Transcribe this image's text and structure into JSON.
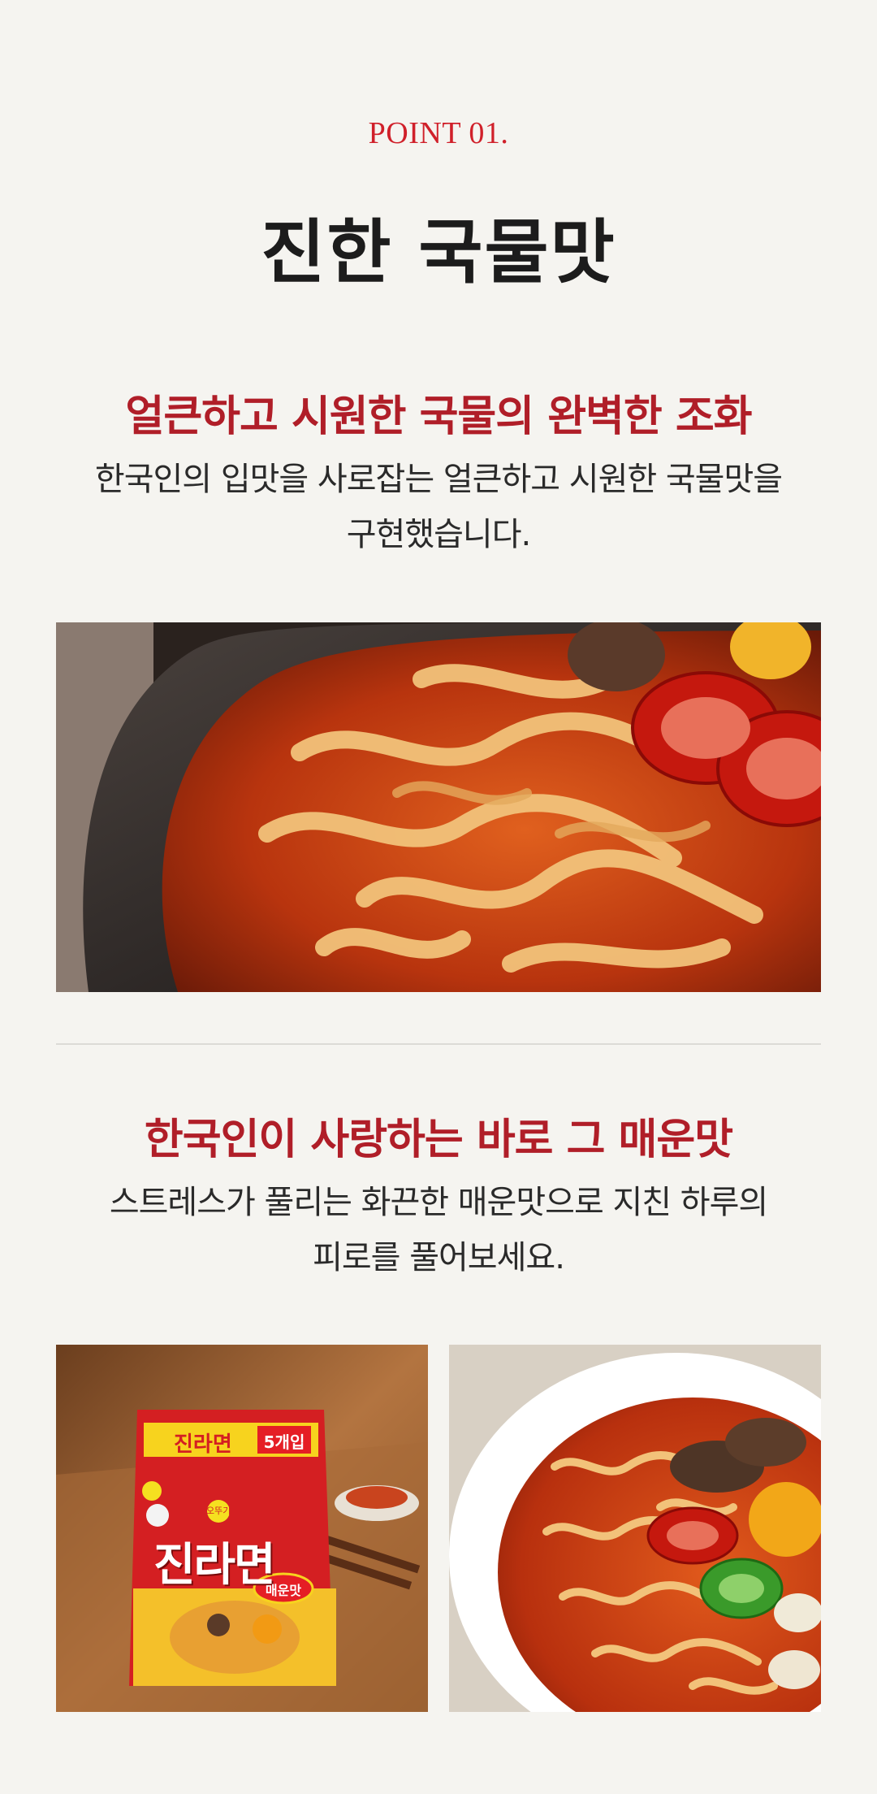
{
  "section": {
    "point_label": "POINT 01.",
    "title": "진한 국물맛"
  },
  "feature1": {
    "heading": "얼큰하고 시원한 국물의 완벽한 조화",
    "desc_line1": "한국인의 입맛을 사로잡는 얼큰하고 시원한 국물맛을",
    "desc_line2": "구현했습니다."
  },
  "feature2": {
    "heading": "한국인이 사랑하는 바로 그 매운맛",
    "desc_line1": "스트레스가 풀리는 화끈한 매운맛으로 지친 하루의",
    "desc_line2": "피로를 풀어보세요."
  },
  "package": {
    "brand_small": "진라면",
    "count": "5개입",
    "maker": "오뚜기",
    "name": "진라면",
    "flavor": "매운맛"
  },
  "colors": {
    "accent": "#d0202a",
    "heading": "#b01e28",
    "background": "#f5f4f0"
  }
}
